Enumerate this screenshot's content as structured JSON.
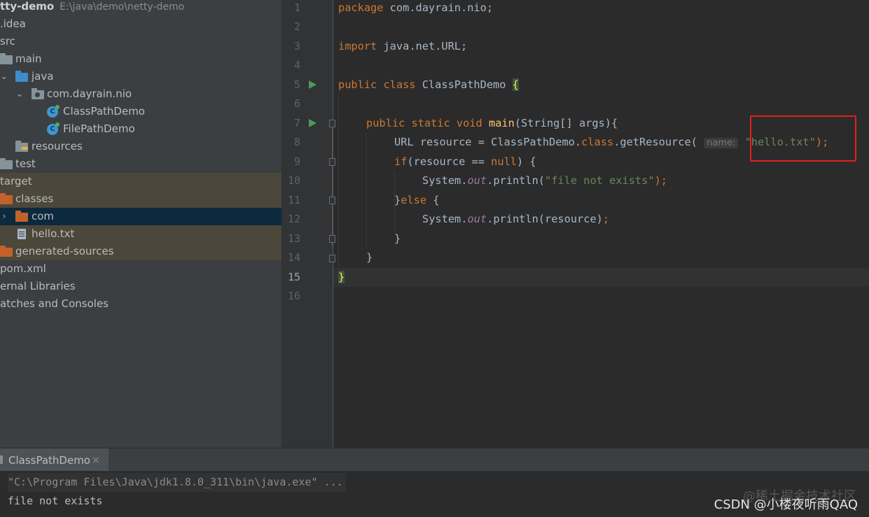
{
  "project": {
    "root_name": "tty-demo",
    "root_path": "E:\\java\\demo\\netty-demo",
    "items": {
      "idea": ".idea",
      "src": "src",
      "main": "main",
      "java": "java",
      "package": "com.dayrain.nio",
      "class1": "ClassPathDemo",
      "class2": "FilePathDemo",
      "resources": "resources",
      "test": "test",
      "target": "target",
      "classes": "classes",
      "com": "com",
      "hello": "hello.txt",
      "generated": "generated-sources",
      "pom": "pom.xml",
      "ext_libs": "ernal Libraries",
      "scratches": "atches and Consoles"
    }
  },
  "editor": {
    "line_numbers": [
      "1",
      "2",
      "3",
      "4",
      "5",
      "6",
      "7",
      "8",
      "9",
      "10",
      "11",
      "12",
      "13",
      "14",
      "15",
      "16"
    ],
    "current_line": 15,
    "code": {
      "l1_kw": "package",
      "l1_rest": " com.dayrain.nio;",
      "l3_kw": "import",
      "l3_rest": " java.net.URL;",
      "l5_kw": "public class",
      "l5_name": " ClassPathDemo ",
      "l5_brace": "{",
      "l7_kw": "public static void",
      "l7_sp": " ",
      "l7_fn": "main",
      "l7_rest": "(String[] args){",
      "l8_a": "URL resource = ClassPathDemo.",
      "l8_kw": "class",
      "l8_b": ".getResource( ",
      "l8_hint": "name:",
      "l8_str": "\"hello.txt\"",
      "l8_end": ");",
      "l9_kw": "if",
      "l9_a": "(resource == ",
      "l9_null": "null",
      "l9_b": ") {",
      "l10_a": "System.",
      "l10_fld": "out",
      "l10_b": ".println(",
      "l10_str": "\"file not exists\"",
      "l10_end": ");",
      "l11_a": "}",
      "l11_kw": "else",
      "l11_b": " {",
      "l12_a": "System.",
      "l12_fld": "out",
      "l12_b": ".println(resource)",
      "l12_end": ";",
      "l13": "}",
      "l14": "}",
      "l15": "}"
    }
  },
  "run_panel": {
    "tab_label": "ClassPathDemo",
    "close_glyph": "×",
    "command": "\"C:\\Program Files\\Java\\jdk1.8.0_311\\bin\\java.exe\" ...",
    "output": "file not exists"
  },
  "watermarks": {
    "juejin": "@稀土掘金技术社区",
    "csdn": "CSDN @小楼夜听雨QAQ"
  },
  "colors": {
    "keyword": "#cc7832",
    "string": "#6a8759",
    "function": "#ffc66d",
    "field": "#9876aa",
    "highlight_box": "#e02020"
  }
}
